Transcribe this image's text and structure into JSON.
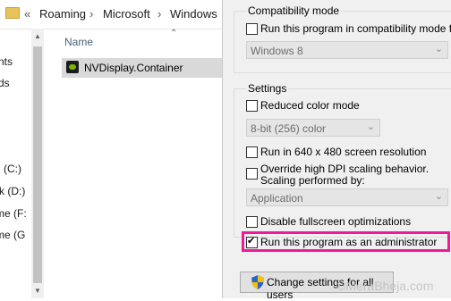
{
  "breadcrumb": {
    "chevron": "«",
    "items": [
      "Roaming",
      "Microsoft",
      "Windows"
    ],
    "separator": "›"
  },
  "nav_pane": {
    "items": [
      "nts",
      "ds",
      "(C:)",
      "k (D:)",
      "me (F:",
      "me (G"
    ]
  },
  "file_list": {
    "column_name": "Name",
    "selected_file": "NVDisplay.Container"
  },
  "properties": {
    "compatibility": {
      "group_title": "Compatibility mode",
      "checkbox_label": "Run this program in compatibility mode for:",
      "checked": false,
      "dropdown_value": "Windows 8"
    },
    "settings": {
      "group_title": "Settings",
      "reduced_color": {
        "label": "Reduced color mode",
        "checked": false
      },
      "color_dropdown": "8-bit (256) color",
      "resolution": {
        "label": "Run in 640 x 480 screen resolution",
        "checked": false
      },
      "dpi": {
        "label_line1": "Override high DPI scaling behavior.",
        "label_line2": "Scaling performed by:",
        "checked": false
      },
      "dpi_dropdown": "Application",
      "fullscreen": {
        "label": "Disable fullscreen optimizations",
        "checked": false
      },
      "admin": {
        "label": "Run this program as an administrator",
        "checked": true
      }
    },
    "change_all_button": "Change settings for all users"
  },
  "watermark": "©MeraBheja.com",
  "colors": {
    "highlight": "#ee1a9a",
    "dialog_bg": "#f0f0f0",
    "selection": "#d9d9d9"
  }
}
